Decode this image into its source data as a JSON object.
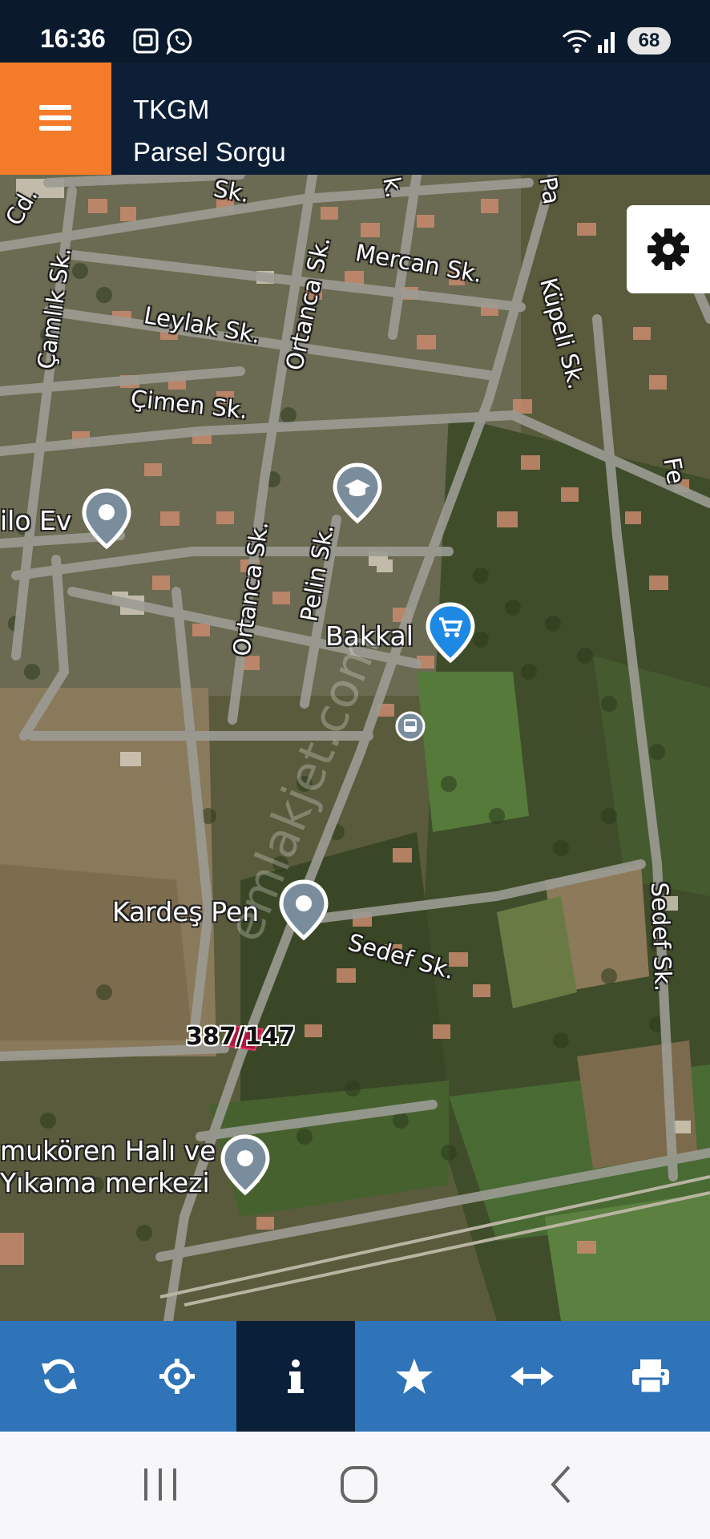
{
  "status_bar": {
    "time": "16:36",
    "battery": "68",
    "left_icons": [
      "screenshot-icon",
      "whatsapp-icon"
    ],
    "right_icons": [
      "wifi-icon",
      "signal-icon"
    ]
  },
  "header": {
    "title": "TKGM",
    "subtitle": "Parsel Sorgu",
    "menu_icon": "hamburger-menu-icon",
    "accent_color": "#f47b2a",
    "background_color": "#0c1f36"
  },
  "map": {
    "street_labels": {
      "camlik": "Çamlık Sk.",
      "ortanca_top": "Ortanca Sk.",
      "mercan": "Mercan Sk.",
      "leylak": "Leylak Sk.",
      "kupeli": "Küpeli Sk.",
      "cimen": "Çimen Sk.",
      "ortanca_mid": "Ortanca Sk.",
      "pelin": "Pelin Sk.",
      "sedef": "Sedef Sk.",
      "sedef_vertical": "Sedef Sk.",
      "cad_fragment": "Cd.",
      "pa_fragment": "Pa",
      "fe_fragment": "Fe",
      "sk_fragment_top": "Sk.",
      "k_fragment": "k."
    },
    "pois": {
      "silo_ev": "ilo Ev",
      "bakkal": "Bakkal",
      "kardes_pen": "Kardeş Pen",
      "hali_line1": "mukören Halı ve",
      "hali_line2": "Yıkama merkezi"
    },
    "watermark": "emlakjet.com",
    "parcel_label": "387/147",
    "parcel_color": "#b0163f"
  },
  "settings": {
    "icon": "gear-icon"
  },
  "toolbar": {
    "buttons": [
      {
        "icon": "refresh-icon",
        "active": false
      },
      {
        "icon": "locate-crosshair-icon",
        "active": false
      },
      {
        "icon": "info-icon",
        "active": true
      },
      {
        "icon": "star-icon",
        "active": false
      },
      {
        "icon": "measure-arrows-icon",
        "active": false
      },
      {
        "icon": "printer-icon",
        "active": false
      }
    ],
    "background_color": "#2f73b8",
    "active_color": "#0a1f38"
  },
  "nav_bar": {
    "buttons": [
      "recent-apps-icon",
      "home-icon",
      "back-icon"
    ]
  }
}
